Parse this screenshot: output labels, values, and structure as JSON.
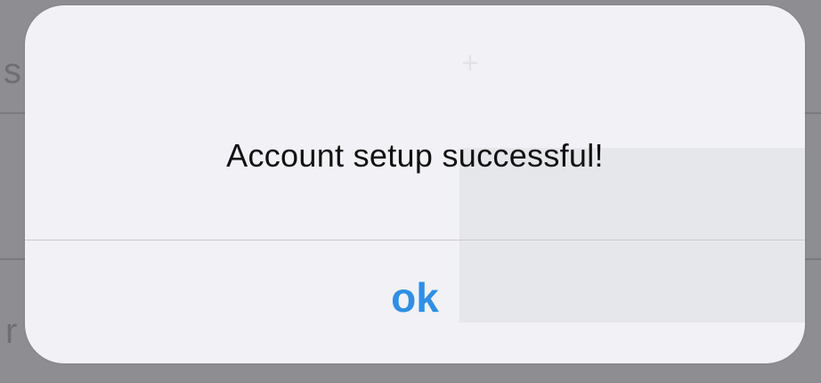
{
  "alert": {
    "message": "Account setup successful!",
    "ok_label": "ok",
    "accent_color": "#2f8fe6"
  },
  "background": {
    "partial_letters": [
      "s",
      "r"
    ]
  }
}
